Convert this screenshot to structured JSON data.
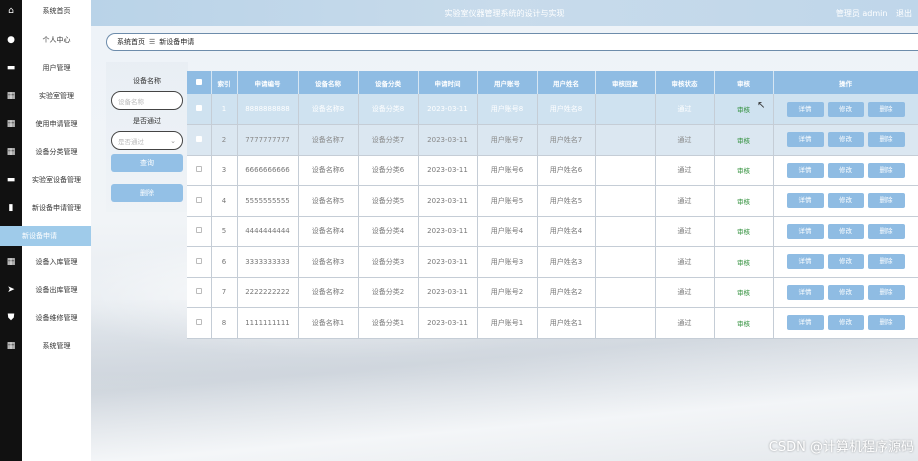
{
  "header": {
    "title": "实验室仪器管理系统的设计与实现",
    "user": "管理员 admin",
    "logout": "退出"
  },
  "breadcrumb": {
    "home": "系统首页",
    "sep": "☰",
    "current": "新设备申请"
  },
  "sidebar": {
    "items": [
      {
        "label": "系统首页",
        "icon": "home-icon"
      },
      {
        "label": "个人中心",
        "icon": "person-icon"
      },
      {
        "label": "用户管理",
        "icon": "user-card-icon"
      },
      {
        "label": "实验室管理",
        "icon": "grid-icon"
      },
      {
        "label": "使用申请管理",
        "icon": "grid-icon"
      },
      {
        "label": "设备分类管理",
        "icon": "grid-icon"
      },
      {
        "label": "实验室设备管理",
        "icon": "user-card-icon"
      },
      {
        "label": "新设备申请管理",
        "icon": "chart-icon"
      },
      {
        "label": "新设备申请",
        "icon": ""
      },
      {
        "label": "设备入库管理",
        "icon": "grid-icon"
      },
      {
        "label": "设备出库管理",
        "icon": "send-icon"
      },
      {
        "label": "设备维修管理",
        "icon": "shield-icon"
      },
      {
        "label": "系统管理",
        "icon": "grid-icon"
      }
    ],
    "active_index": 8
  },
  "search": {
    "name_label": "设备名称",
    "name_placeholder": "设备名称",
    "pass_label": "是否通过",
    "pass_placeholder": "是否通过",
    "query_btn": "查询",
    "delete_btn": "删除"
  },
  "table": {
    "headers": [
      "索引",
      "申请编号",
      "设备名称",
      "设备分类",
      "申请时间",
      "用户账号",
      "用户姓名",
      "审核回复",
      "审核状态",
      "审核",
      "操作"
    ],
    "rows": [
      {
        "idx": "1",
        "no": "8888888888",
        "name": "设备名称8",
        "cat": "设备分类8",
        "time": "2023-03-11",
        "acct": "用户账号8",
        "uname": "用户姓名8",
        "reply": "",
        "status": "通过",
        "audit": "审核"
      },
      {
        "idx": "2",
        "no": "7777777777",
        "name": "设备名称7",
        "cat": "设备分类7",
        "time": "2023-03-11",
        "acct": "用户账号7",
        "uname": "用户姓名7",
        "reply": "",
        "status": "通过",
        "audit": "审核"
      },
      {
        "idx": "3",
        "no": "6666666666",
        "name": "设备名称6",
        "cat": "设备分类6",
        "time": "2023-03-11",
        "acct": "用户账号6",
        "uname": "用户姓名6",
        "reply": "",
        "status": "通过",
        "audit": "审核"
      },
      {
        "idx": "4",
        "no": "5555555555",
        "name": "设备名称5",
        "cat": "设备分类5",
        "time": "2023-03-11",
        "acct": "用户账号5",
        "uname": "用户姓名5",
        "reply": "",
        "status": "通过",
        "audit": "审核"
      },
      {
        "idx": "5",
        "no": "4444444444",
        "name": "设备名称4",
        "cat": "设备分类4",
        "time": "2023-03-11",
        "acct": "用户账号4",
        "uname": "用户姓名4",
        "reply": "",
        "status": "通过",
        "audit": "审核"
      },
      {
        "idx": "6",
        "no": "3333333333",
        "name": "设备名称3",
        "cat": "设备分类3",
        "time": "2023-03-11",
        "acct": "用户账号3",
        "uname": "用户姓名3",
        "reply": "",
        "status": "通过",
        "audit": "审核"
      },
      {
        "idx": "7",
        "no": "2222222222",
        "name": "设备名称2",
        "cat": "设备分类2",
        "time": "2023-03-11",
        "acct": "用户账号2",
        "uname": "用户姓名2",
        "reply": "",
        "status": "通过",
        "audit": "审核"
      },
      {
        "idx": "8",
        "no": "1111111111",
        "name": "设备名称1",
        "cat": "设备分类1",
        "time": "2023-03-11",
        "acct": "用户账号1",
        "uname": "用户姓名1",
        "reply": "",
        "status": "通过",
        "audit": "审核"
      }
    ],
    "actions": [
      "详情",
      "修改",
      "删除"
    ]
  },
  "watermark": "CSDN @计算机程序源码",
  "colors": {
    "accent": "#8fbce3",
    "active_nav": "#9fcbea",
    "audit_green": "#2f8f3a"
  }
}
